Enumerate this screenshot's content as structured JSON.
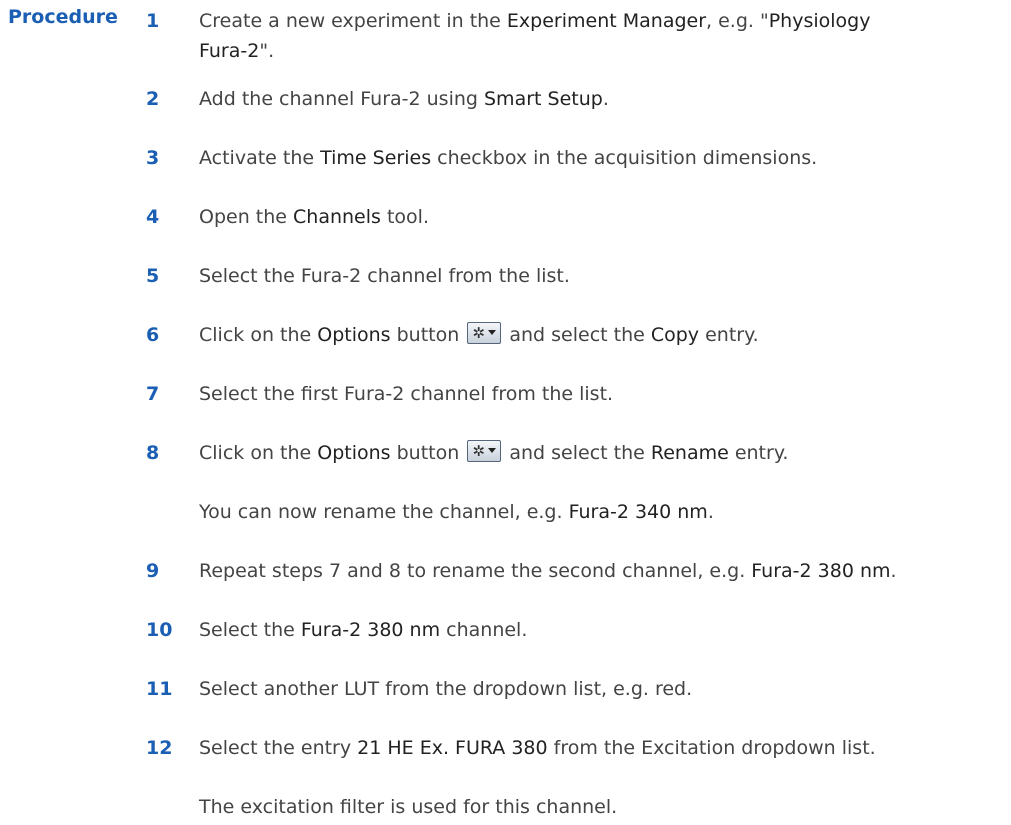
{
  "heading": "Procedure",
  "steps": [
    {
      "num": "1",
      "parts": [
        "Create a new experiment in the ",
        "Experiment Manager",
        ", e.g. \"",
        "Physiology",
        ""
      ],
      "line2": [
        "Fura-2",
        "\"."
      ]
    },
    {
      "num": "2",
      "parts": [
        "Add the channel Fura-2 using ",
        "Smart Setup",
        "."
      ]
    },
    {
      "num": "3",
      "parts": [
        "Activate the ",
        "Time Series",
        " checkbox in the acquisition dimensions."
      ]
    },
    {
      "num": "4",
      "parts": [
        "Open the ",
        "Channels",
        " tool."
      ]
    },
    {
      "num": "5",
      "parts": [
        "Select the Fura-2 channel from the list."
      ]
    },
    {
      "num": "6",
      "parts": [
        "Click on the ",
        "Options",
        " button ",
        " and select the ",
        "Copy",
        " entry."
      ],
      "icon": "gear-dropdown-icon"
    },
    {
      "num": "7",
      "parts": [
        "Select the first Fura-2 channel from the list."
      ]
    },
    {
      "num": "8",
      "parts": [
        "Click on the ",
        "Options",
        " button ",
        " and select the ",
        "Rename",
        " entry."
      ],
      "icon": "gear-dropdown-icon"
    },
    {
      "num": "",
      "parts": [
        "You can now rename the channel, e.g. ",
        "Fura-2 340 nm",
        "."
      ]
    },
    {
      "num": "9",
      "parts": [
        "Repeat steps 7 and 8 to rename the second channel, e.g. ",
        "Fura-2 380 nm",
        "."
      ]
    },
    {
      "num": "10",
      "parts": [
        "Select the ",
        "Fura-2 380 nm",
        " channel."
      ]
    },
    {
      "num": "11",
      "parts": [
        "Select another LUT from the dropdown list, e.g. red."
      ]
    },
    {
      "num": "12",
      "parts": [
        "Select the entry ",
        "21 HE Ex. FURA 380",
        " from the Excitation dropdown list."
      ]
    },
    {
      "num": "",
      "parts": [
        "The excitation filter is used for this channel."
      ]
    }
  ],
  "colors": {
    "accent": "#1a5fb4",
    "text": "#444444",
    "emphasis": "#222222"
  }
}
